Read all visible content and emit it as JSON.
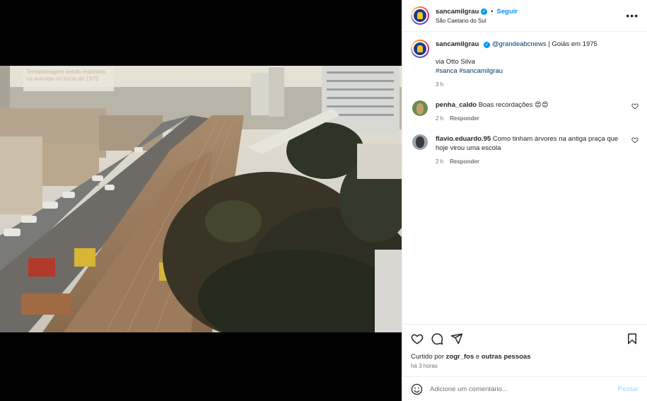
{
  "header": {
    "username": "sancamilgrau",
    "follow_label": "Seguir",
    "location": "São Caetano do Sul",
    "more_icon": "more-horizontal-icon"
  },
  "media": {
    "overlay_text": "Terraplanagem sendo realizada na avenida no início de 1975"
  },
  "caption": {
    "username": "sancamilgrau",
    "mention": "@grandeabcnews",
    "text": " | Goiás em 1975",
    "line2": "via Otto Silva",
    "hashtags": "#sanca #sancamilgrau",
    "time": "3 h"
  },
  "comments": [
    {
      "username": "penha_caldo",
      "text": "Boas recordações 😍😍",
      "time": "2 h",
      "reply_label": "Responder"
    },
    {
      "username": "flavio.eduardo.95",
      "text": "Como tinham árvores na antiga praça que hoje virou uma escola",
      "time": "2 h",
      "reply_label": "Responder"
    }
  ],
  "likes": {
    "prefix": "Curtido por ",
    "user": "zogr_fos",
    "middle": " e ",
    "rest": "outras pessoas"
  },
  "post_time": "há 3 horas",
  "add_comment": {
    "placeholder": "Adicione um comentário...",
    "post_label": "Postar"
  },
  "colors": {
    "accent": "#0095f6",
    "post_disabled": "#b2dffc",
    "meta": "#737373"
  }
}
